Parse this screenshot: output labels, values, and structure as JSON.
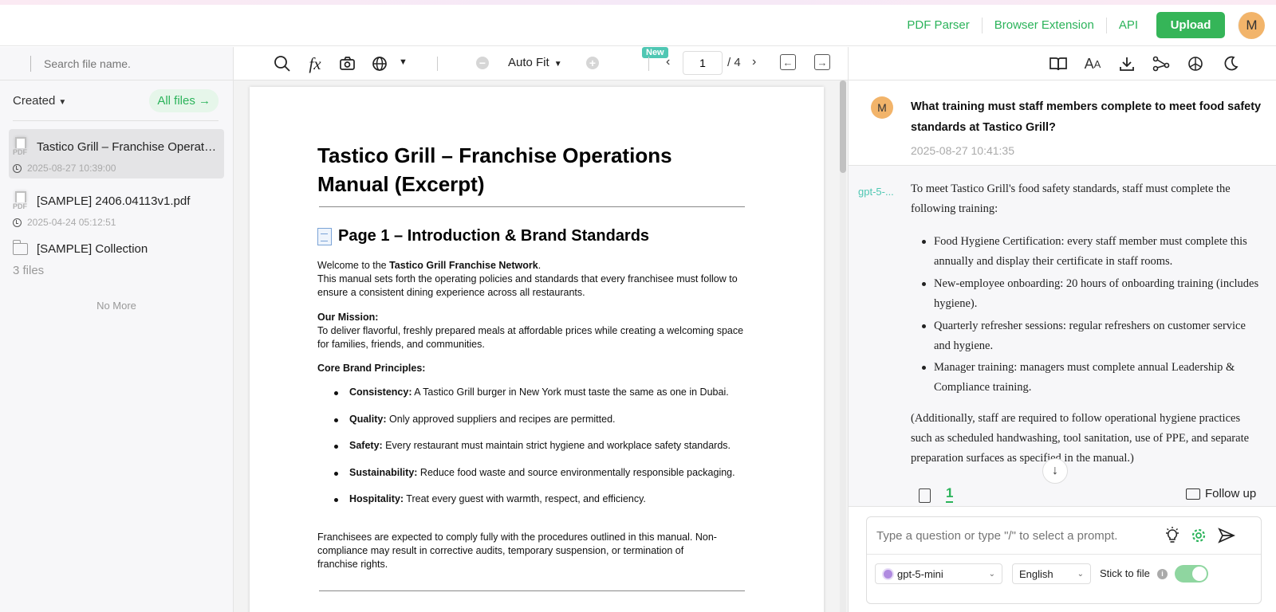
{
  "header": {
    "links": [
      "PDF Parser",
      "Browser Extension",
      "API"
    ],
    "upload_label": "Upload",
    "avatar_letter": "M"
  },
  "sidebar": {
    "search_placeholder": "Search file name.",
    "sort_label": "Created",
    "all_files_label": "All files",
    "files": [
      {
        "name": "Tastico Grill – Franchise Operations Manual (Excerpt).pdf",
        "date": "2025-08-27 10:39:00",
        "icon": "pdf-file-icon"
      },
      {
        "name": "[SAMPLE] 2406.04113v1.pdf",
        "date": "2025-04-24 05:12:51",
        "icon": "pdf-file-icon"
      }
    ],
    "folder": {
      "name": "[SAMPLE] Collection",
      "count": "3 files"
    },
    "no_more": "No More"
  },
  "toolbar": {
    "new_badge": "New",
    "zoom_label": "Auto Fit",
    "page_current": "1",
    "page_total": "/ 4",
    "icons": [
      "search-icon",
      "formula-icon",
      "screenshot-icon",
      "translate-icon",
      "zoom-out-icon",
      "zoom-in-icon",
      "prev-page-icon",
      "next-page-icon",
      "collapse-left-icon",
      "collapse-right-icon"
    ]
  },
  "document": {
    "title": "Tastico Grill – Franchise Operations Manual (Excerpt)",
    "section_heading": "Page 1 – Introduction & Brand Standards",
    "welcome_prefix": "Welcome to the ",
    "welcome_bold": "Tastico Grill Franchise Network",
    "welcome_suffix": ".",
    "intro": " This manual sets forth the operating policies and standards that every franchisee must follow to ensure a consistent dining experience across all restaurants.",
    "mission_heading": "Our Mission:",
    "mission_text": " To deliver flavorful, freshly prepared meals at affordable prices while creating a welcoming space for families, friends, and communities.",
    "principles_heading": "Core Brand Principles:",
    "principles": [
      {
        "label": "Consistency:",
        "text": " A Tastico Grill burger in New York must taste the same as one in Dubai."
      },
      {
        "label": "Quality:",
        "text": " Only approved suppliers and recipes are permitted."
      },
      {
        "label": "Safety:",
        "text": " Every restaurant must maintain strict hygiene and workplace safety standards."
      },
      {
        "label": "Sustainability:",
        "text": " Reduce food waste and source environmentally responsible packaging."
      },
      {
        "label": "Hospitality:",
        "text": " Treat every guest with warmth, respect, and efficiency."
      }
    ],
    "closing": "Franchisees are expected to comply fully with the procedures outlined in this manual. Non-compliance may result in corrective audits, temporary suspension, or termination of franchise rights."
  },
  "right_toolbar": {
    "icons": [
      "book-icon",
      "font-size-icon",
      "download-icon",
      "mindmap-icon",
      "openai-icon",
      "dark-mode-icon"
    ]
  },
  "chat": {
    "question": "What training must staff members complete to meet food safety standards at Tastico Grill?",
    "question_time": "2025-08-27 10:41:35",
    "avatar_letter": "M",
    "model_tag": "gpt-5-...",
    "answer_intro": "To meet Tastico Grill's food safety standards, staff must complete the following training:",
    "answer_bullets": [
      "Food Hygiene Certification: every staff member must complete this annually and display their certificate in staff rooms.",
      "New-employee onboarding: 20 hours of onboarding training (includes hygiene).",
      "Quarterly refresher sessions: regular refreshers on customer service and hygiene.",
      "Manager training: managers must complete annual Leadership & Compliance training."
    ],
    "answer_note": "(Additionally, staff are required to follow operational hygiene practices such as scheduled handwashing, tool sanitation, use of PPE, and separate preparation surfaces as specified in the manual.)",
    "ref_count": "1",
    "follow_up_label": "Follow up"
  },
  "composer": {
    "placeholder": "Type a question or type \"/\" to select a prompt.",
    "model_select": "gpt-5-mini",
    "language_select": "English",
    "stick_label": "Stick to file",
    "stick_enabled": true
  }
}
